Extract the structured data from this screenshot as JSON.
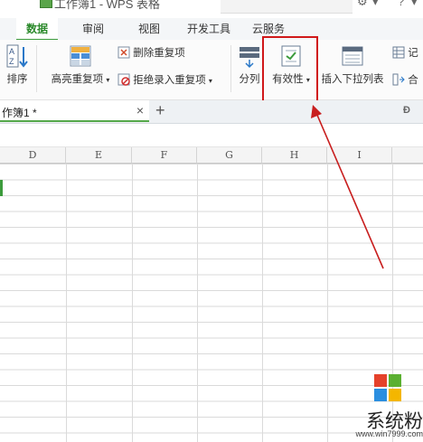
{
  "window": {
    "title": "工作簿1 - WPS 表格",
    "controls": [
      "⚙",
      "▾",
      "?",
      "▾"
    ]
  },
  "ribbon_tabs": [
    {
      "label": "数据",
      "active": true
    },
    {
      "label": "审阅",
      "active": false
    },
    {
      "label": "视图",
      "active": false
    },
    {
      "label": "开发工具",
      "active": false
    },
    {
      "label": "云服务",
      "active": false
    }
  ],
  "ribbon": {
    "sort": "排序",
    "highlight_dup": "高亮重复项",
    "delete_dup": "删除重复项",
    "reject_dup": "拒绝录入重复项",
    "split": "分列",
    "validity": "有效性",
    "insert_dropdown": "插入下拉列表",
    "record": "记",
    "merge": "合"
  },
  "doc_tab": {
    "label": "作簿1 *",
    "close": "×",
    "add": "+"
  },
  "columns": [
    "D",
    "E",
    "F",
    "G",
    "H",
    "I"
  ],
  "colors": {
    "accent": "#3c9b3c",
    "highlight_box": "#d0181a",
    "arrow": "#c81e1e"
  },
  "watermark": {
    "brand": "系统粉",
    "url": "www.win7999.com"
  }
}
